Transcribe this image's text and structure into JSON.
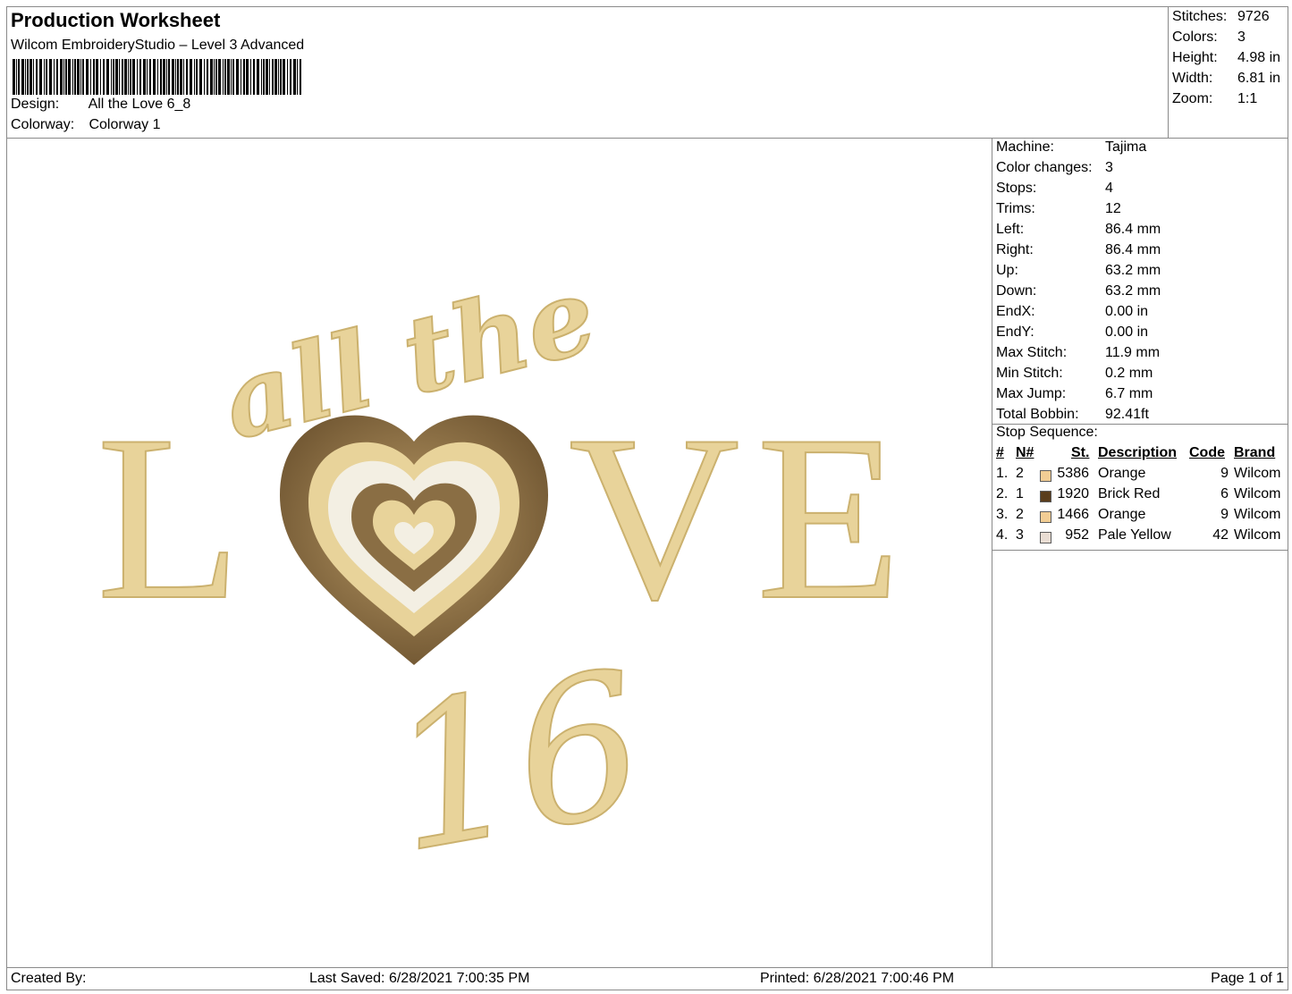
{
  "header": {
    "title": "Production Worksheet",
    "subtitle": "Wilcom EmbroideryStudio – Level 3 Advanced",
    "design_label": "Design:",
    "design_value": "All the Love 6_8",
    "colorway_label": "Colorway:",
    "colorway_value": "Colorway 1"
  },
  "summary": [
    {
      "label": "Stitches:",
      "value": "9726"
    },
    {
      "label": "Colors:",
      "value": "3"
    },
    {
      "label": "Height:",
      "value": "4.98 in"
    },
    {
      "label": "Width:",
      "value": "6.81 in"
    },
    {
      "label": "Zoom:",
      "value": "1:1"
    }
  ],
  "machine_info": [
    {
      "label": "Machine:",
      "value": "Tajima"
    },
    {
      "label": "Color changes:",
      "value": "3"
    },
    {
      "label": "Stops:",
      "value": "4"
    },
    {
      "label": "Trims:",
      "value": "12"
    },
    {
      "label": "Left:",
      "value": "86.4 mm"
    },
    {
      "label": "Right:",
      "value": "86.4 mm"
    },
    {
      "label": "Up:",
      "value": "63.2 mm"
    },
    {
      "label": "Down:",
      "value": "63.2 mm"
    },
    {
      "label": "EndX:",
      "value": "0.00 in"
    },
    {
      "label": "EndY:",
      "value": "0.00 in"
    },
    {
      "label": "Max Stitch:",
      "value": "11.9 mm"
    },
    {
      "label": "Min Stitch:",
      "value": "0.2 mm"
    },
    {
      "label": "Max Jump:",
      "value": "6.7 mm"
    },
    {
      "label": "Total Bobbin:",
      "value": "92.41ft"
    }
  ],
  "stop_sequence": {
    "title": "Stop Sequence:",
    "headers": {
      "num": "#",
      "n": "N#",
      "st": "St.",
      "description": "Description",
      "code": "Code",
      "brand": "Brand"
    },
    "rows": [
      {
        "num": "1.",
        "n": "2",
        "color": "#f2cd94",
        "st": "5386",
        "description": "Orange",
        "code": "9",
        "brand": "Wilcom"
      },
      {
        "num": "2.",
        "n": "1",
        "color": "#5a3d1c",
        "st": "1920",
        "description": "Brick Red",
        "code": "6",
        "brand": "Wilcom"
      },
      {
        "num": "3.",
        "n": "2",
        "color": "#f2cd94",
        "st": "1466",
        "description": "Orange",
        "code": "9",
        "brand": "Wilcom"
      },
      {
        "num": "4.",
        "n": "3",
        "color": "#e9ddd3",
        "st": "952",
        "description": "Pale Yellow",
        "code": "42",
        "brand": "Wilcom"
      }
    ]
  },
  "design_art": {
    "script_line": "all the",
    "letter_l": "L",
    "letter_v": "V",
    "letter_e": "E",
    "script_number": "16",
    "thread_gold": "#e8d39a",
    "thread_gold_dark": "#cbb16e",
    "thread_brown": "#8a6e44",
    "thread_cream": "#f3efe3"
  },
  "footer": {
    "created_by": "Created By:",
    "last_saved": "Last Saved: 6/28/2021 7:00:35 PM",
    "printed": "Printed: 6/28/2021 7:00:46 PM",
    "page": "Page 1 of 1"
  }
}
